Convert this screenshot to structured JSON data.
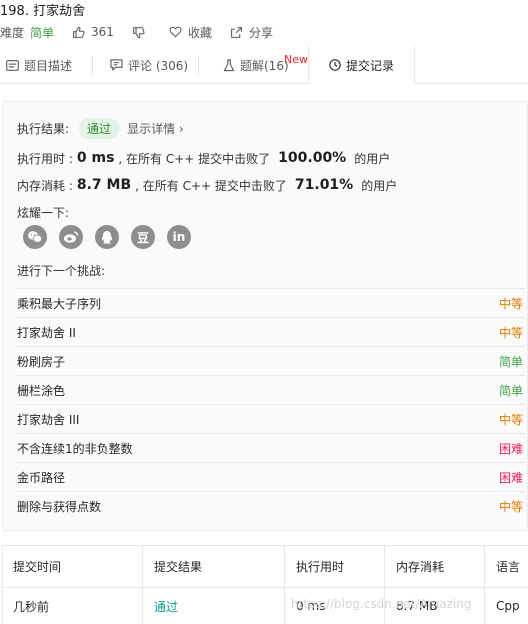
{
  "header": {
    "title": "198. 打家劫舍",
    "difficulty_label": "难度",
    "difficulty_value": "简单",
    "likes": "361",
    "favorite_label": "收藏",
    "share_label": "分享"
  },
  "tabs": {
    "description": "题目描述",
    "comments": "评论 (306)",
    "solutions": "题解(16)",
    "new_badge": "New",
    "submissions": "提交记录"
  },
  "result": {
    "label": "执行结果:",
    "status": "通过",
    "details_link": "显示详情 ›",
    "runtime_label": "执行用时 :",
    "runtime_value": "0 ms",
    "runtime_mid": ", 在所有 C++ 提交中击败了",
    "runtime_pct": "100.00%",
    "runtime_suffix": "的用户",
    "memory_label": "内存消耗 :",
    "memory_value": "8.7 MB",
    "memory_mid": ", 在所有 C++ 提交中击败了",
    "memory_pct": "71.01%",
    "memory_suffix": "的用户",
    "share_label": "炫耀一下:",
    "share_icons": [
      "wechat-icon",
      "weibo-icon",
      "qq-icon",
      "douban-icon",
      "linkedin-icon"
    ],
    "douban_glyph": "豆",
    "linkedin_glyph": "in"
  },
  "next_challenges": {
    "label": "进行下一个挑战:",
    "items": [
      {
        "name": "乘积最大子序列",
        "level": "中等",
        "color": "#e07b00"
      },
      {
        "name": "打家劫舍 II",
        "level": "中等",
        "color": "#e07b00"
      },
      {
        "name": "粉刷房子",
        "level": "简单",
        "color": "#43a047"
      },
      {
        "name": "栅栏涂色",
        "level": "简单",
        "color": "#43a047"
      },
      {
        "name": "打家劫舍 III",
        "level": "中等",
        "color": "#e07b00"
      },
      {
        "name": "不含连续1的非负整数",
        "level": "困难",
        "color": "#e91e63"
      },
      {
        "name": "金币路径",
        "level": "困难",
        "color": "#e91e63"
      },
      {
        "name": "删除与获得点数",
        "level": "中等",
        "color": "#e07b00"
      }
    ]
  },
  "submissions_table": {
    "headers": [
      "提交时间",
      "提交结果",
      "执行用时",
      "内存消耗",
      "语言"
    ],
    "rows": [
      {
        "time": "几秒前",
        "result": "通过",
        "runtime": "0 ms",
        "memory": "8.7 MB",
        "language": "Cpp"
      }
    ]
  },
  "watermark": "https://blog.csdn.net/Amazing",
  "colors": {
    "accent_green": "#43a047",
    "pass_teal": "#0b9a8d"
  }
}
